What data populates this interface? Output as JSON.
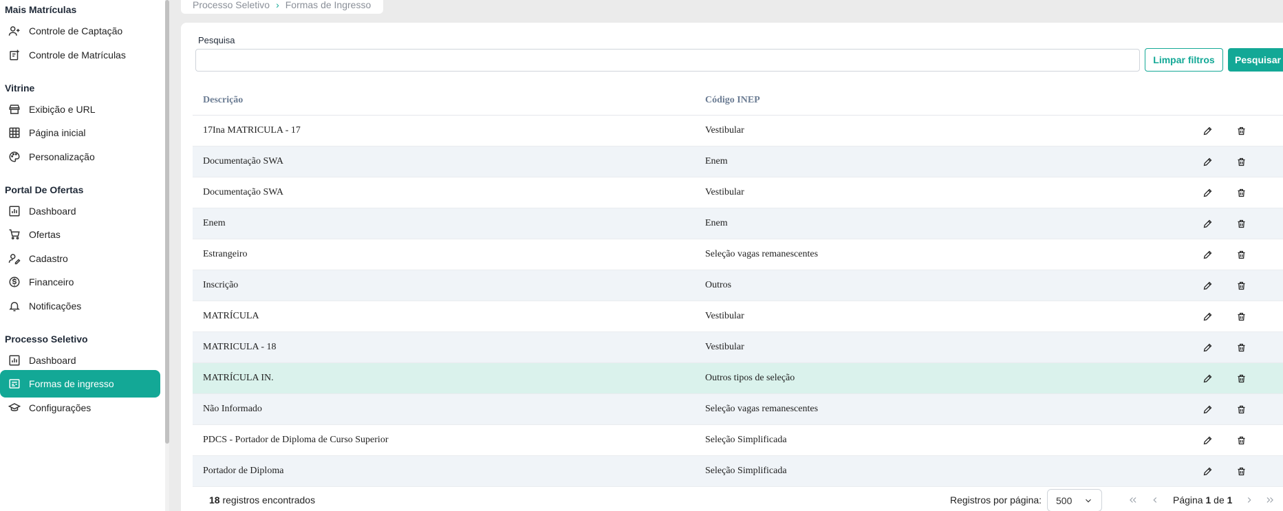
{
  "sidebar": {
    "sections": [
      {
        "title": "Mais Matrículas",
        "items": [
          {
            "label": "Controle de Captação",
            "icon": "user-plus-icon"
          },
          {
            "label": "Controle de Matrículas",
            "icon": "document-plus-icon"
          }
        ]
      },
      {
        "title": "Vitrine",
        "items": [
          {
            "label": "Exibição e URL",
            "icon": "storefront-icon"
          },
          {
            "label": "Página inicial",
            "icon": "grid-layout-icon"
          },
          {
            "label": "Personalização",
            "icon": "palette-icon"
          }
        ]
      },
      {
        "title": "Portal De Ofertas",
        "items": [
          {
            "label": "Dashboard",
            "icon": "bar-chart-icon"
          },
          {
            "label": "Ofertas",
            "icon": "cart-icon"
          },
          {
            "label": "Cadastro",
            "icon": "user-edit-icon"
          },
          {
            "label": "Financeiro",
            "icon": "dollar-circle-icon"
          },
          {
            "label": "Notificações",
            "icon": "bell-icon"
          }
        ]
      },
      {
        "title": "Processo Seletivo",
        "items": [
          {
            "label": "Dashboard",
            "icon": "bar-chart-icon"
          },
          {
            "label": "Formas de ingresso",
            "icon": "form-icon",
            "active": true
          },
          {
            "label": "Configurações",
            "icon": "graduation-cap-icon"
          }
        ]
      }
    ]
  },
  "breadcrumb": {
    "parent": "Processo Seletivo",
    "current": "Formas de Ingresso"
  },
  "search": {
    "label": "Pesquisa",
    "value": "",
    "clear_label": "Limpar filtros",
    "submit_label": "Pesquisar"
  },
  "table": {
    "columns": [
      "Descrição",
      "Código INEP"
    ],
    "rows": [
      {
        "descricao": "17Ina MATRICULA - 17",
        "codigo": "Vestibular"
      },
      {
        "descricao": "Documentação SWA",
        "codigo": "Enem"
      },
      {
        "descricao": "Documentação SWA",
        "codigo": "Vestibular"
      },
      {
        "descricao": "Enem",
        "codigo": "Enem"
      },
      {
        "descricao": "Estrangeiro",
        "codigo": "Seleção vagas remanescentes"
      },
      {
        "descricao": "Inscrição",
        "codigo": "Outros"
      },
      {
        "descricao": "MATRÍCULA",
        "codigo": "Vestibular"
      },
      {
        "descricao": "MATRICULA - 18",
        "codigo": "Vestibular"
      },
      {
        "descricao": "MATRÍCULA IN.",
        "codigo": "Outros tipos de seleção",
        "highlighted": true
      },
      {
        "descricao": "Não Informado",
        "codigo": "Seleção vagas remanescentes"
      },
      {
        "descricao": "PDCS - Portador de Diploma de Curso Superior",
        "codigo": "Seleção Simplificada"
      },
      {
        "descricao": "Portador de Diploma",
        "codigo": "Seleção Simplificada"
      }
    ]
  },
  "footer": {
    "count": "18",
    "count_suffix": "registros encontrados",
    "rpp_label": "Registros por página:",
    "rpp_value": "500",
    "page_prefix": "Página",
    "page_current": "1",
    "page_of": "de",
    "page_total": "1"
  },
  "colors": {
    "accent": "#13a896",
    "row_alt": "#f0f4f8",
    "row_highlight": "#daf2ec"
  }
}
